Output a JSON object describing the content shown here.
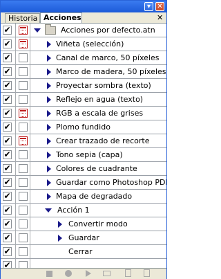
{
  "window": {
    "minimize_glyph": "▾",
    "close_glyph": "✕"
  },
  "tabs": [
    {
      "label": "Historia",
      "active": false
    },
    {
      "label": "Acciones",
      "active": true
    }
  ],
  "tabs_close_glyph": "✕",
  "check_glyph": "✔",
  "actions": [
    {
      "label": "Acciones por defecto.atn",
      "type": "set",
      "expanded": true,
      "checked": true,
      "dialog": true
    },
    {
      "label": "Viñeta (selección)",
      "type": "action",
      "expanded": false,
      "checked": true,
      "dialog": true
    },
    {
      "label": "Canal de marco, 50 píxeles",
      "type": "action",
      "expanded": false,
      "checked": true,
      "dialog": false
    },
    {
      "label": "Marco de madera, 50 píxeles",
      "type": "action",
      "expanded": false,
      "checked": true,
      "dialog": false
    },
    {
      "label": "Proyectar sombra (texto)",
      "type": "action",
      "expanded": false,
      "checked": true,
      "dialog": false
    },
    {
      "label": "Reflejo en agua (texto)",
      "type": "action",
      "expanded": false,
      "checked": true,
      "dialog": false
    },
    {
      "label": "RGB a escala de grises",
      "type": "action",
      "expanded": false,
      "checked": true,
      "dialog": true
    },
    {
      "label": "Plomo fundido",
      "type": "action",
      "expanded": false,
      "checked": true,
      "dialog": false
    },
    {
      "label": "Crear trazado de recorte",
      "type": "action",
      "expanded": false,
      "checked": true,
      "dialog": true
    },
    {
      "label": "Tono sepia (capa)",
      "type": "action",
      "expanded": false,
      "checked": true,
      "dialog": false
    },
    {
      "label": "Colores de cuadrante",
      "type": "action",
      "expanded": false,
      "checked": true,
      "dialog": false
    },
    {
      "label": "Guardar como Photoshop PDF",
      "type": "action",
      "expanded": false,
      "checked": true,
      "dialog": false
    },
    {
      "label": "Mapa de degradado",
      "type": "action",
      "expanded": false,
      "checked": true,
      "dialog": false
    },
    {
      "label": "Acción 1",
      "type": "action",
      "expanded": true,
      "checked": true,
      "dialog": false
    },
    {
      "label": "Convertir modo",
      "type": "step",
      "expanded": false,
      "checked": true,
      "dialog": false
    },
    {
      "label": "Guardar",
      "type": "step",
      "expanded": false,
      "checked": true,
      "dialog": false
    },
    {
      "label": "Cerrar",
      "type": "step-leaf",
      "expanded": false,
      "checked": true,
      "dialog": false
    },
    {
      "label": "",
      "type": "empty",
      "checked": true,
      "dialog": false
    }
  ],
  "bottom_tools": [
    {
      "name": "stop-icon"
    },
    {
      "name": "record-icon"
    },
    {
      "name": "play-icon"
    },
    {
      "name": "new-set-icon"
    },
    {
      "name": "new-action-icon"
    },
    {
      "name": "trash-icon"
    }
  ],
  "colors": {
    "titlebar": "#1c5ad8",
    "dialog_icon": "#c02020",
    "triangle": "#1a1a8a"
  }
}
